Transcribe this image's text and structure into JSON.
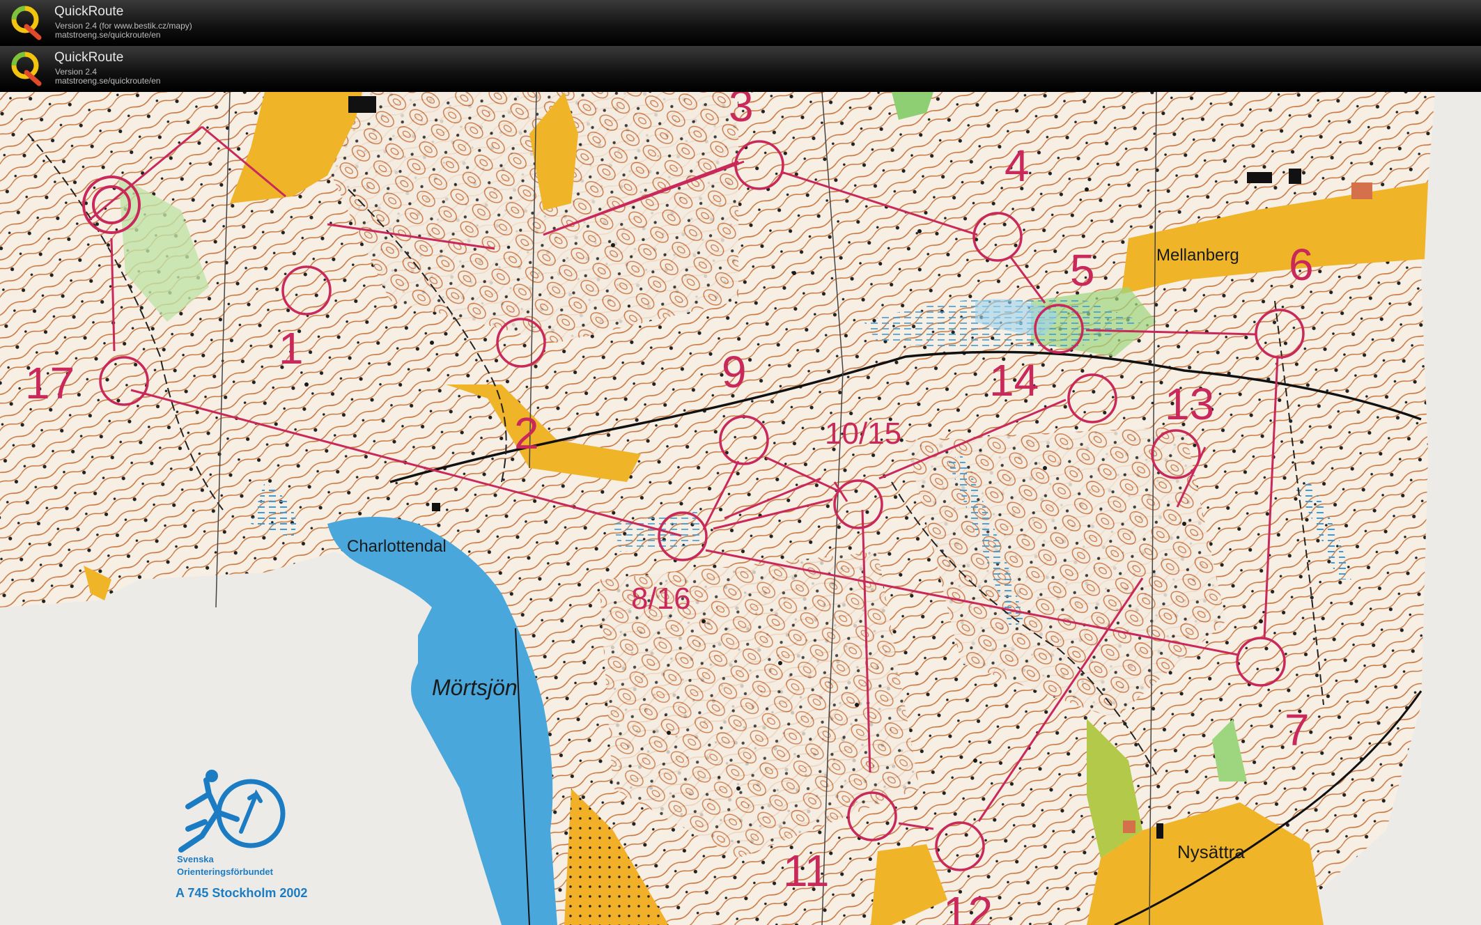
{
  "header": [
    {
      "app_name": "QuickRoute",
      "version": "Version 2.4  (for www.bestik.cz/mapy)",
      "url": "matstroeng.se/quickroute/en"
    },
    {
      "app_name": "QuickRoute",
      "version": "Version 2.4",
      "url": "matstroeng.se/quickroute/en"
    }
  ],
  "map": {
    "place_names": {
      "charlottendal": "Charlottendal",
      "mortsjon": "Mörtsjön",
      "mellanberg": "Mellanberg",
      "nysattra": "Nysättra"
    },
    "controls": [
      "1",
      "2",
      "3",
      "4",
      "5",
      "6",
      "7",
      "8/16",
      "9",
      "10/15",
      "11",
      "12",
      "13",
      "14",
      "17"
    ],
    "federation": {
      "line1": "Svenska",
      "line2": "Orienteringsförbundet",
      "map_id": "A 745 Stockholm 2002"
    },
    "colors": {
      "course": "#c8285a",
      "water": "#4aa8dc",
      "contour": "#c0622a",
      "open_land": "#f0b428",
      "forest": "#f6efe5"
    }
  }
}
